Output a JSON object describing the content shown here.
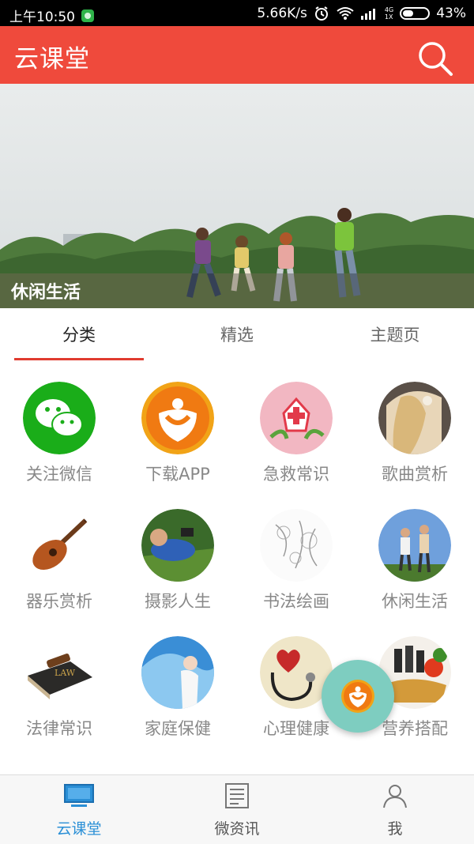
{
  "status_bar": {
    "time": "上午10:50",
    "speed": "5.66K/s",
    "network": "4G",
    "network_sub": "1X",
    "battery": "43%",
    "battery_level": 0.43
  },
  "app_bar": {
    "title": "云课堂",
    "search_icon": "search-icon"
  },
  "banner": {
    "caption": "休闲生活"
  },
  "tabs": [
    {
      "label": "分类",
      "active": true
    },
    {
      "label": "精选",
      "active": false
    },
    {
      "label": "主题页",
      "active": false
    }
  ],
  "grid": {
    "items": [
      {
        "label": "关注微信",
        "icon": "wechat-icon"
      },
      {
        "label": "下载APP",
        "icon": "app-logo-icon"
      },
      {
        "label": "急救常识",
        "icon": "first-aid-icon"
      },
      {
        "label": "歌曲赏析",
        "icon": "singer-photo-icon"
      },
      {
        "label": "器乐赏析",
        "icon": "guitar-icon"
      },
      {
        "label": "摄影人生",
        "icon": "camera-boy-icon"
      },
      {
        "label": "书法绘画",
        "icon": "sketch-flower-icon"
      },
      {
        "label": "休闲生活",
        "icon": "couple-photo-icon"
      },
      {
        "label": "法律常识",
        "icon": "law-book-icon"
      },
      {
        "label": "家庭保健",
        "icon": "health-photo-icon"
      },
      {
        "label": "心理健康",
        "icon": "stethoscope-heart-icon"
      },
      {
        "label": "营养搭配",
        "icon": "vegetables-icon"
      }
    ]
  },
  "bottom_nav": [
    {
      "label": "云课堂",
      "icon": "monitor-icon",
      "active": true
    },
    {
      "label": "微资讯",
      "icon": "news-icon",
      "active": false
    },
    {
      "label": "我",
      "icon": "person-icon",
      "active": false
    }
  ],
  "colors": {
    "brand_red": "#ef4a3c",
    "active_tab_underline": "#e03b2f",
    "nav_active": "#2a8fd6",
    "fab": "#7ecdc0"
  }
}
